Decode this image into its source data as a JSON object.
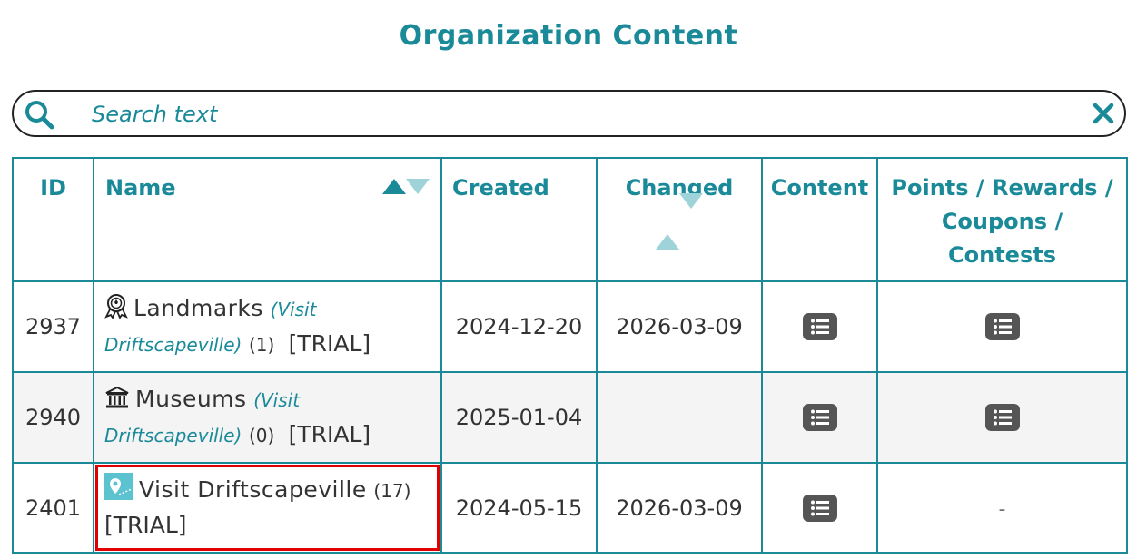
{
  "page": {
    "title": "Organization Content"
  },
  "search": {
    "placeholder": "Search text"
  },
  "table": {
    "headers": {
      "id": "ID",
      "name": "Name",
      "created": "Created",
      "changed": "Changed",
      "content": "Content",
      "points_line1": "Points / Rewards /",
      "points_line2": "Coupons /",
      "points_line3": "Contests"
    },
    "rows": [
      {
        "id": "2937",
        "icon": "landmark-award-icon",
        "name": "Landmarks",
        "org": "(Visit Driftscapeville)",
        "count": "(1)",
        "trial": "[TRIAL]",
        "created": "2024-12-20",
        "changed": "2026-03-09",
        "content_icon": "list-icon",
        "points_icon": "list-icon",
        "points_text": ""
      },
      {
        "id": "2940",
        "icon": "museum-icon",
        "name": "Museums",
        "org": "(Visit Driftscapeville)",
        "count": "(0)",
        "trial": "[TRIAL]",
        "created": "2025-01-04",
        "changed": "",
        "content_icon": "list-icon",
        "points_icon": "list-icon",
        "points_text": ""
      },
      {
        "id": "2401",
        "icon": "map-pin-icon",
        "name": "Visit Driftscapeville",
        "org": "",
        "count": "(17)",
        "trial": "[TRIAL]",
        "created": "2024-05-15",
        "changed": "2026-03-09",
        "content_icon": "list-icon",
        "points_icon": "",
        "points_text": "-"
      }
    ]
  },
  "colors": {
    "accent": "#1a8a99",
    "accent_light": "#9ed4d9",
    "highlight": "#e00000",
    "icon_dark": "#555555"
  }
}
